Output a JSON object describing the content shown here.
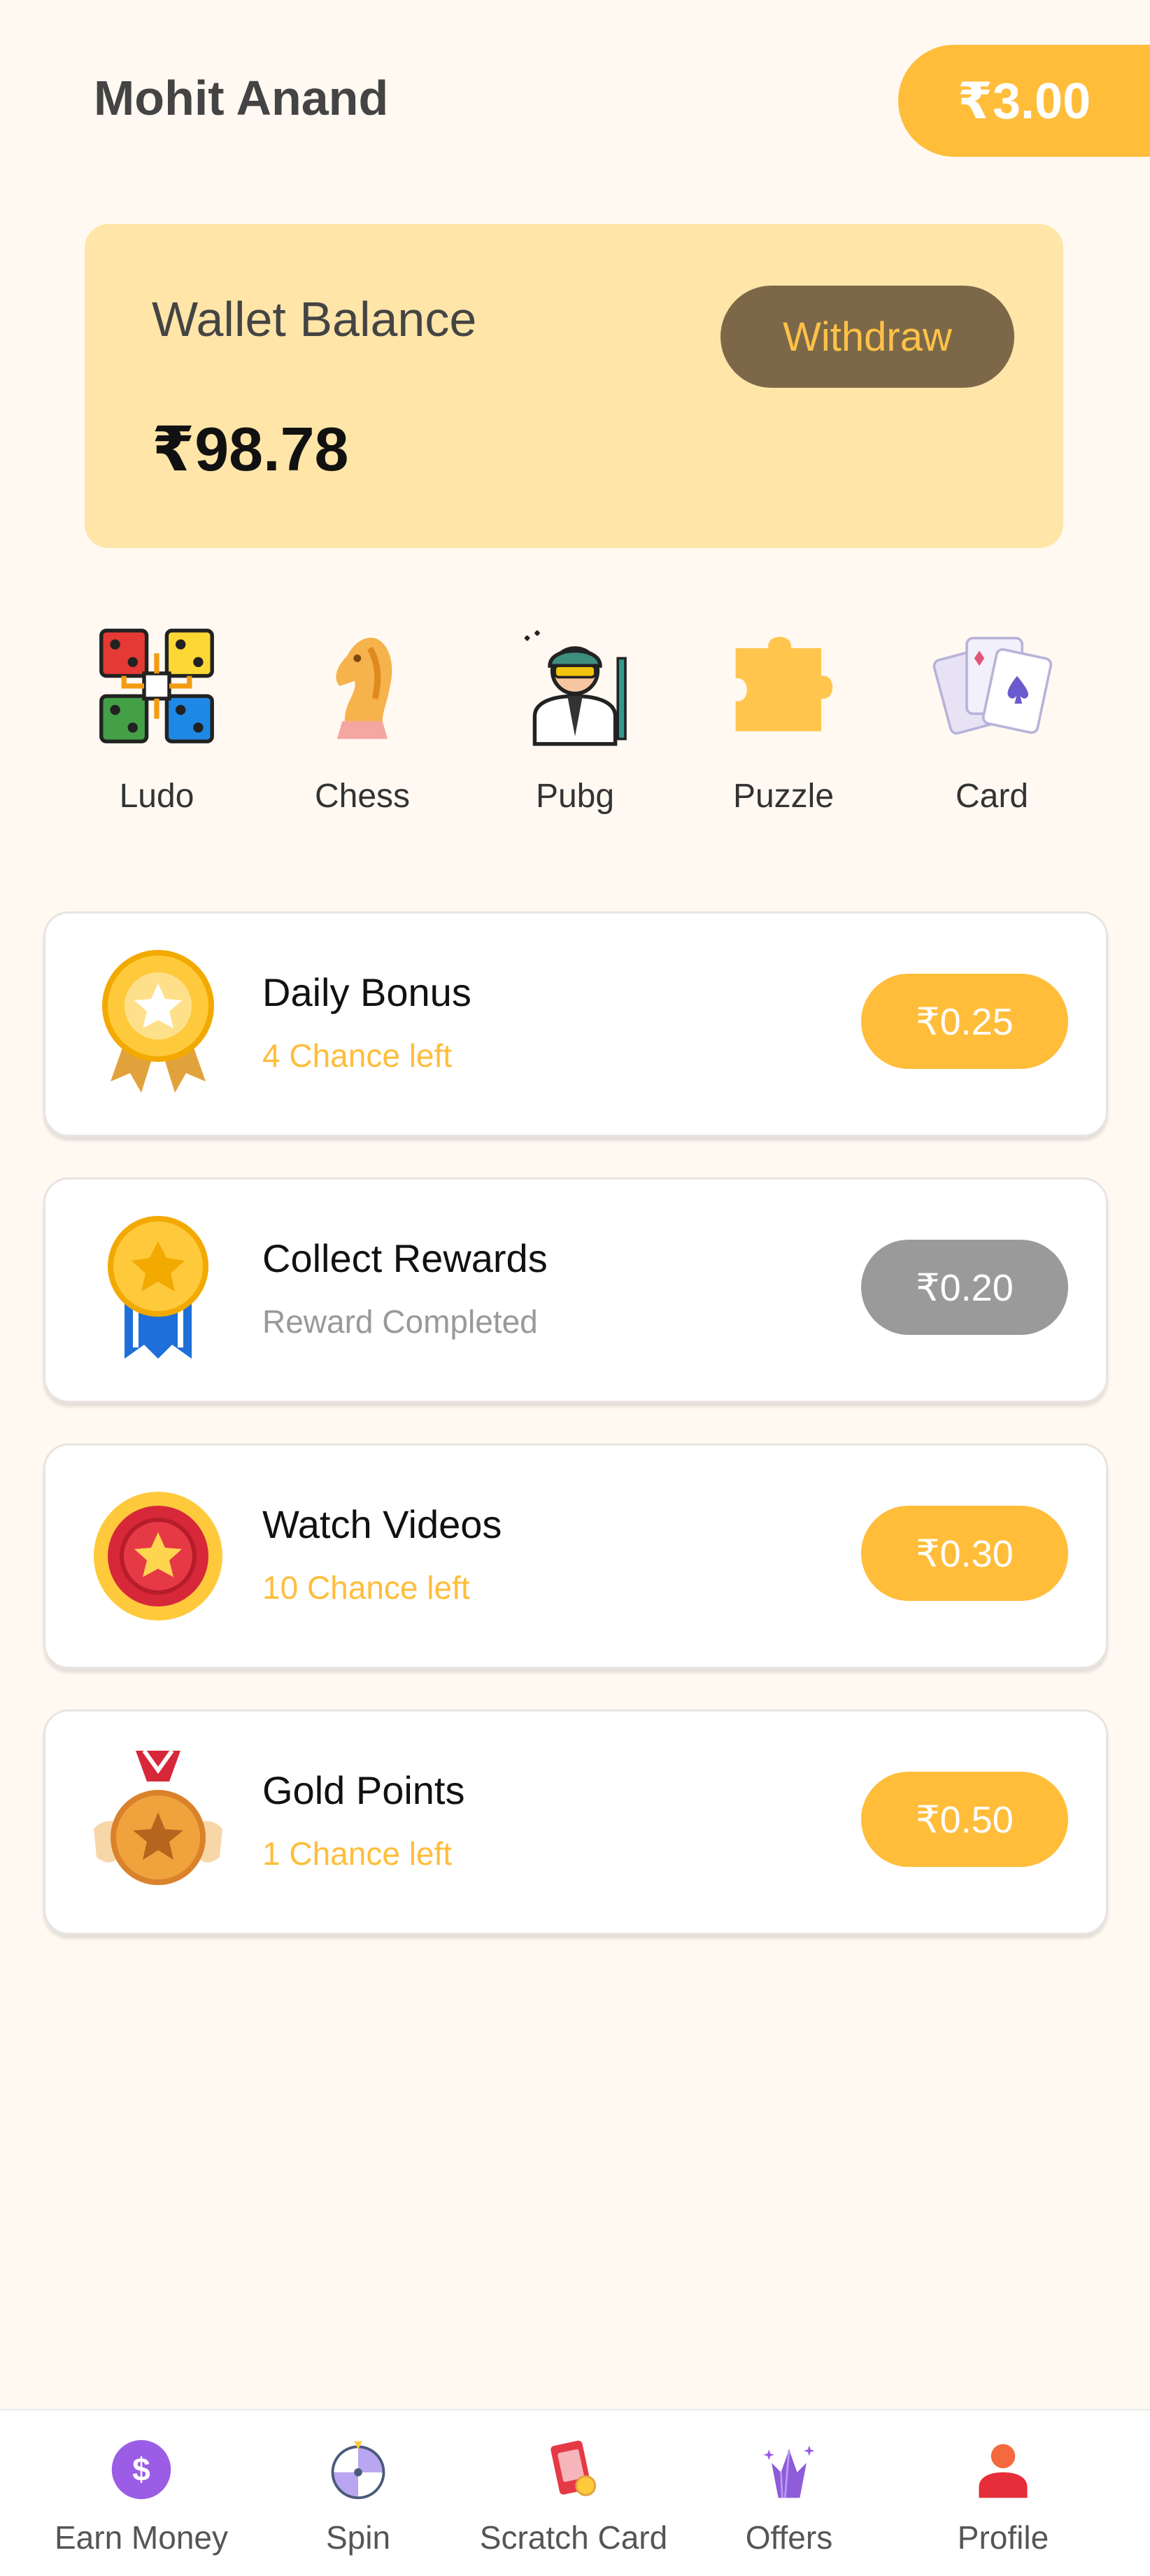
{
  "header": {
    "user_name": "Mohit Anand",
    "coin_balance": "₹3.00"
  },
  "wallet": {
    "label": "Wallet Balance",
    "amount": "₹98.78",
    "withdraw_label": "Withdraw"
  },
  "games": [
    {
      "label": "Ludo",
      "icon": "ludo-board-icon"
    },
    {
      "label": "Chess",
      "icon": "chess-knight-icon"
    },
    {
      "label": "Pubg",
      "icon": "soldier-icon"
    },
    {
      "label": "Puzzle",
      "icon": "puzzle-piece-icon"
    },
    {
      "label": "Card",
      "icon": "playing-cards-icon"
    }
  ],
  "tasks": [
    {
      "title": "Daily Bonus",
      "subtitle": "4 Chance left",
      "reward": "₹0.25",
      "icon": "gold-medal-star-icon",
      "completed": false
    },
    {
      "title": "Collect Rewards",
      "subtitle": "Reward Completed",
      "reward": "₹0.20",
      "icon": "medal-ribbon-icon",
      "completed": true
    },
    {
      "title": "Watch Videos",
      "subtitle": "10 Chance left",
      "reward": "₹0.30",
      "icon": "red-badge-star-icon",
      "completed": false
    },
    {
      "title": "Gold Points",
      "subtitle": "1 Chance left",
      "reward": "₹0.50",
      "icon": "winged-medal-icon",
      "completed": false
    }
  ],
  "bottom_nav": [
    {
      "label": "Earn Money",
      "icon": "dollar-coin-icon"
    },
    {
      "label": "Spin",
      "icon": "spin-wheel-icon"
    },
    {
      "label": "Scratch Card",
      "icon": "scratch-card-icon"
    },
    {
      "label": "Offers",
      "icon": "offers-crystal-icon"
    },
    {
      "label": "Profile",
      "icon": "profile-icon"
    }
  ],
  "colors": {
    "background": "#FFF9F2",
    "accent": "#FFBD3A",
    "wallet_card": "#FFE5A8",
    "withdraw_button": "#7C6848",
    "disabled_button": "#9A9A9A"
  }
}
